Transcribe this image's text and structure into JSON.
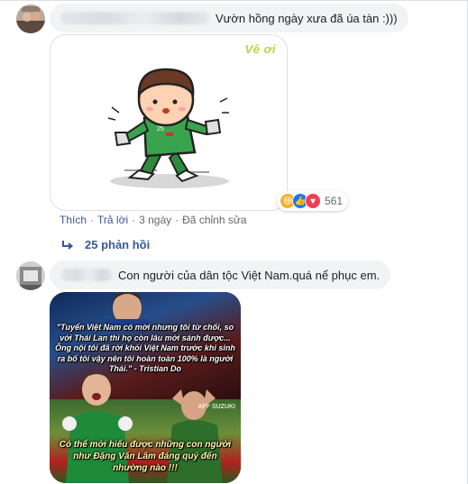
{
  "comments": [
    {
      "text": "Vườn hồng ngày xưa đã úa tàn :)))",
      "sticker": {
        "watermark": "Vê ơi"
      },
      "reactions": {
        "icons": [
          "haha-icon",
          "like-icon",
          "love-icon"
        ],
        "count": "561"
      },
      "actions": {
        "like": "Thích",
        "reply": "Trả lời",
        "time": "3 ngày",
        "edited": "Đã chỉnh sửa",
        "separator": "·"
      },
      "replies_label": "25 phản hồi"
    },
    {
      "text": "Con người của dân tộc Việt Nam.quá nể phục em.",
      "photo": {
        "quote": "\"Tuyển Việt Nam có mời nhưng tôi từ chối, so với Thái Lan thì họ còn lâu mới sánh được... Ông nội tôi đã rời khỏi Việt Nam trước khi sinh ra bố tôi vậy nên tôi hoàn toàn 100% là người Thái.\" - Tristian Do",
        "caption": "Có thể mới hiểu được những con người như Đặng Văn Lâm đáng quý đến nhường nào !!!",
        "logo": "AFF SUZUKI"
      }
    }
  ],
  "colors": {
    "bubble": "#f2f3f5",
    "link": "#385898",
    "meta": "#606770",
    "haha": "#f7b125",
    "like": "#1877f2",
    "love": "#f33e58"
  }
}
